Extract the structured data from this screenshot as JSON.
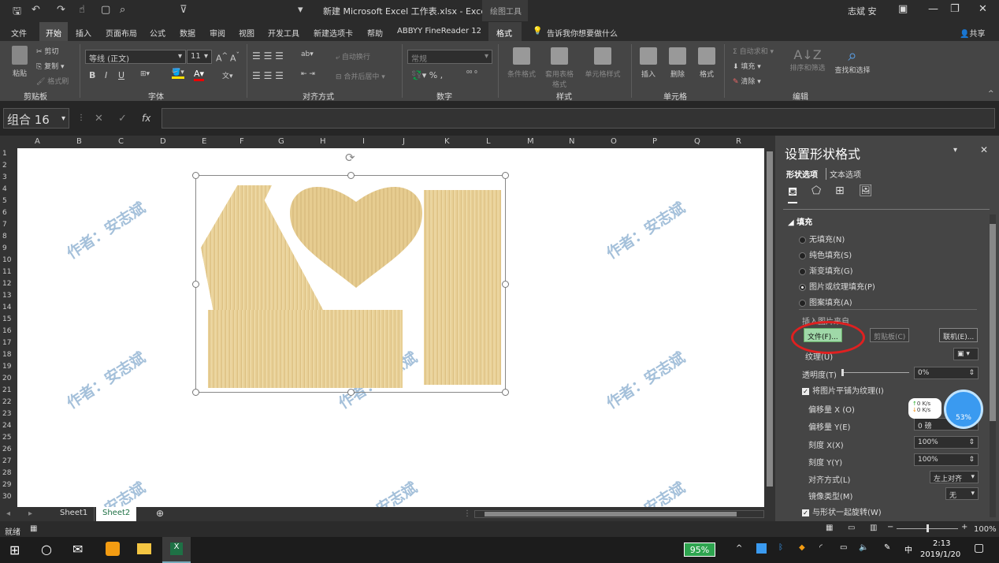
{
  "window": {
    "title": "新建 Microsoft Excel 工作表.xlsx - Excel",
    "context_tab": "绘图工具",
    "user": "志斌 安"
  },
  "tabs": [
    "文件",
    "开始",
    "插入",
    "页面布局",
    "公式",
    "数据",
    "审阅",
    "视图",
    "开发工具",
    "新建选项卡",
    "帮助",
    "ABBYY FineReader 12",
    "格式"
  ],
  "tell_me": "告诉我你想要做什么",
  "share": "共享",
  "ribbon": {
    "clipboard": {
      "paste": "粘贴",
      "cut": "剪切",
      "copy": "复制",
      "painter": "格式刷",
      "label": "剪贴板"
    },
    "font": {
      "name": "等线 (正文)",
      "size": "11",
      "bold": "B",
      "italic": "I",
      "underline": "U",
      "label": "字体"
    },
    "align": {
      "wrap": "自动换行",
      "merge": "合并后居中",
      "label": "对齐方式"
    },
    "number": {
      "format": "常规",
      "label": "数字"
    },
    "styles": {
      "cond": "条件格式",
      "table": "套用表格格式",
      "cell": "单元格样式",
      "label": "样式"
    },
    "cells": {
      "insert": "插入",
      "delete": "删除",
      "format": "格式",
      "label": "单元格"
    },
    "edit": {
      "autosum": "自动求和",
      "fill": "填充",
      "clear": "清除",
      "sort": "排序和筛选",
      "find": "查找和选择",
      "label": "编辑"
    }
  },
  "namebox": "组合 16",
  "columns": [
    "A",
    "B",
    "C",
    "D",
    "E",
    "F",
    "G",
    "H",
    "I",
    "J",
    "K",
    "L",
    "M",
    "N",
    "O",
    "P",
    "Q",
    "R"
  ],
  "rows": [
    "1",
    "2",
    "3",
    "4",
    "5",
    "6",
    "7",
    "8",
    "9",
    "10",
    "11",
    "12",
    "13",
    "14",
    "15",
    "16",
    "17",
    "18",
    "19",
    "20",
    "21",
    "22",
    "23",
    "24",
    "25",
    "26",
    "27",
    "28",
    "29",
    "30"
  ],
  "watermark": "作者：安志斌",
  "sheets": [
    "Sheet1",
    "Sheet2"
  ],
  "status": {
    "ready": "就绪",
    "zoom": "100%"
  },
  "pane": {
    "title": "设置形状格式",
    "tab_shape": "形状选项",
    "tab_text": "文本选项",
    "section": "填充",
    "options": [
      "无填充(N)",
      "纯色填充(S)",
      "渐变填充(G)",
      "图片或纹理填充(P)",
      "图案填充(A)"
    ],
    "insert_from": "插入图片来自",
    "file_btn": "文件(F)...",
    "clipboard_btn": "剪贴板(C)",
    "online_btn": "联机(E)...",
    "texture": "纹理(U)",
    "transparency": "透明度(T)",
    "transparency_val": "0%",
    "tile": "将图片平铺为纹理(I)",
    "offset_x": "偏移量 X (O)",
    "offset_y": "偏移量 Y(E)",
    "offset_y_val": "0 磅",
    "scale_x": "刻度 X(X)",
    "scale_x_val": "100%",
    "scale_y": "刻度 Y(Y)",
    "scale_y_val": "100%",
    "align": "对齐方式(L)",
    "align_val": "左上对齐",
    "mirror": "镜像类型(M)",
    "mirror_val": "无",
    "rotate": "与形状一起旋转(W)"
  },
  "widget": {
    "up": "0",
    "down": "0",
    "unit": "K/s",
    "pct": "53%"
  },
  "taskbar": {
    "battery": "95%",
    "time": "2:13",
    "date": "2019/1/20",
    "ime": "中"
  },
  "colors": {
    "highlight": "#e02020",
    "file_btn": "#9fd8a8"
  }
}
